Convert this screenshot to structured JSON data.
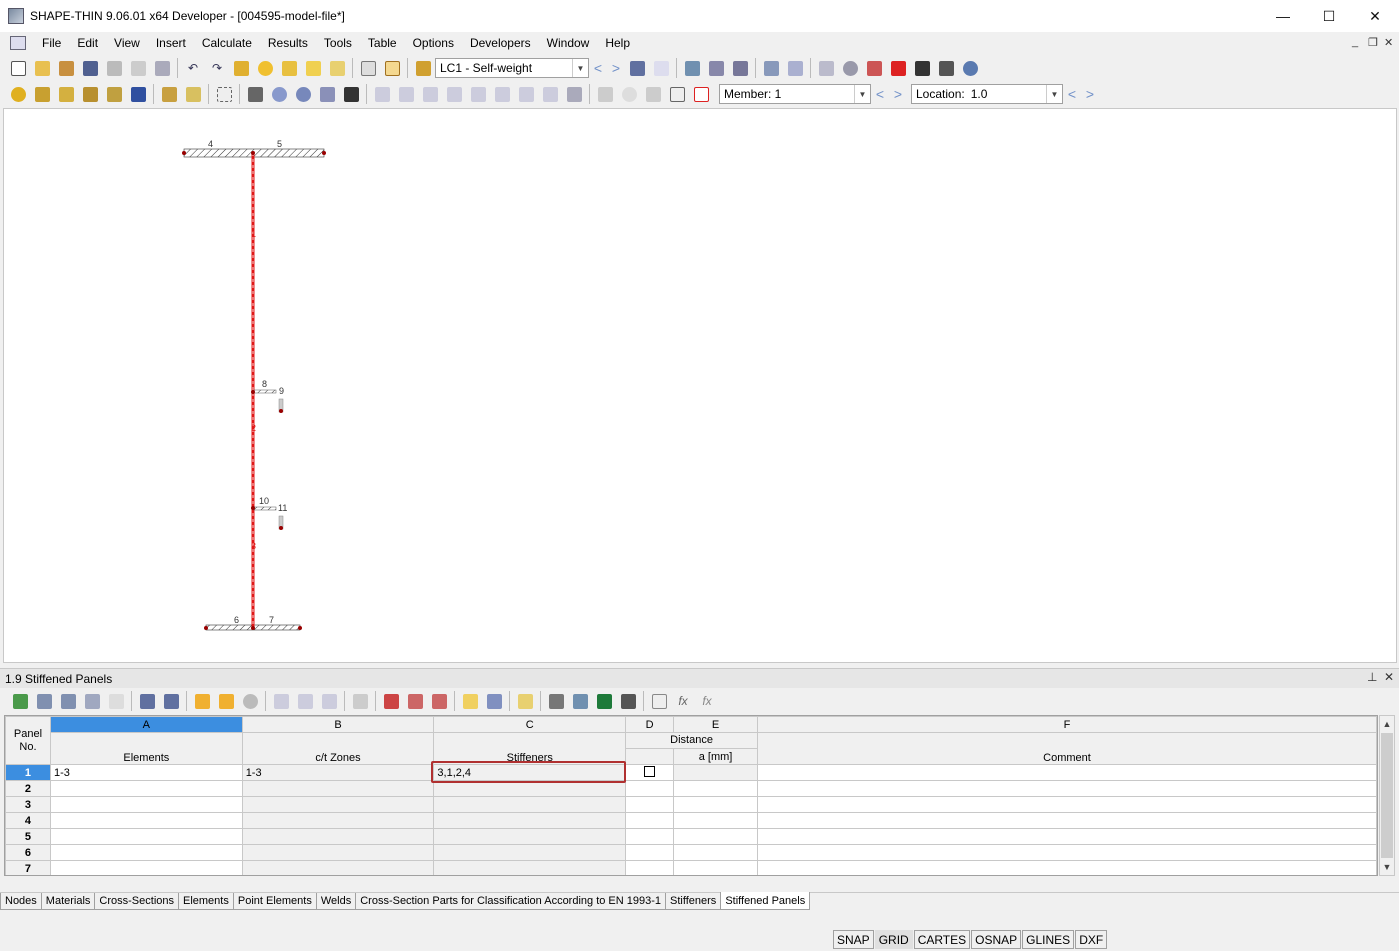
{
  "window": {
    "title": "SHAPE-THIN 9.06.01 x64 Developer - [004595-model-file*]",
    "minimize": "—",
    "maximize": "☐",
    "close": "✕"
  },
  "menu": [
    "File",
    "Edit",
    "View",
    "Insert",
    "Calculate",
    "Results",
    "Tools",
    "Table",
    "Options",
    "Developers",
    "Window",
    "Help"
  ],
  "toolbar": {
    "loadcase": "LC1 - Self-weight",
    "member_label": "Member: 1",
    "location_label": "Location:",
    "location_value": "1.0"
  },
  "model": {
    "node_labels": [
      "4",
      "5",
      "8",
      "9",
      "10",
      "11",
      "6",
      "7"
    ],
    "element_labels": [
      "1",
      "2",
      "3"
    ]
  },
  "panel": {
    "title": "1.9 Stiffened Panels"
  },
  "table": {
    "col_letters": [
      "A",
      "B",
      "C",
      "D",
      "E",
      "F"
    ],
    "header": {
      "panel_no": "Panel\nNo.",
      "elements": "Elements",
      "ct_zones": "c/t Zones",
      "stiffeners": "Stiffeners",
      "distance": "Distance",
      "distance_unit": "a [mm]",
      "comment": "Comment"
    },
    "rows": [
      {
        "no": "1",
        "elements": "1-3",
        "ct_zones": "1-3",
        "stiffeners": "3,1,2,4",
        "distance": "",
        "comment": ""
      },
      {
        "no": "2",
        "elements": "",
        "ct_zones": "",
        "stiffeners": "",
        "distance": "",
        "comment": ""
      },
      {
        "no": "3",
        "elements": "",
        "ct_zones": "",
        "stiffeners": "",
        "distance": "",
        "comment": ""
      },
      {
        "no": "4",
        "elements": "",
        "ct_zones": "",
        "stiffeners": "",
        "distance": "",
        "comment": ""
      },
      {
        "no": "5",
        "elements": "",
        "ct_zones": "",
        "stiffeners": "",
        "distance": "",
        "comment": ""
      },
      {
        "no": "6",
        "elements": "",
        "ct_zones": "",
        "stiffeners": "",
        "distance": "",
        "comment": ""
      },
      {
        "no": "7",
        "elements": "",
        "ct_zones": "",
        "stiffeners": "",
        "distance": "",
        "comment": ""
      }
    ]
  },
  "tabs": [
    "Nodes",
    "Materials",
    "Cross-Sections",
    "Elements",
    "Point Elements",
    "Welds",
    "Cross-Section Parts for Classification According to EN 1993-1",
    "Stiffeners",
    "Stiffened Panels"
  ],
  "status": [
    "SNAP",
    "GRID",
    "CARTES",
    "OSNAP",
    "GLINES",
    "DXF"
  ],
  "colors": {
    "member": "#e01818",
    "selection": "#3c8ee0",
    "highlight": "#b03030"
  }
}
